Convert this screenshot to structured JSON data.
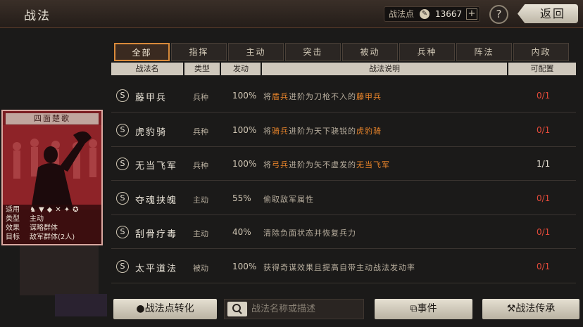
{
  "header": {
    "title": "战法",
    "points_label": "战法点",
    "points_value": "13667",
    "plus_label": "+",
    "help_label": "?",
    "back_label": "返回"
  },
  "card": {
    "name": "四面楚歌",
    "use_label": "适用",
    "type_label": "类型",
    "type_value": "主动",
    "effect_label": "效果",
    "effect_value": "谋略群体",
    "target_label": "目标",
    "target_value": "敌军群体(2人)"
  },
  "tabs": [
    {
      "label": "全部",
      "active": true
    },
    {
      "label": "指挥",
      "active": false
    },
    {
      "label": "主动",
      "active": false
    },
    {
      "label": "突击",
      "active": false
    },
    {
      "label": "被动",
      "active": false
    },
    {
      "label": "兵种",
      "active": false
    },
    {
      "label": "阵法",
      "active": false
    },
    {
      "label": "内政",
      "active": false
    }
  ],
  "columns": [
    "战法名",
    "类型",
    "发动",
    "战法说明",
    "可配置"
  ],
  "rows": [
    {
      "grade": "S",
      "name": "藤甲兵",
      "type": "兵种",
      "rate": "100%",
      "desc_parts": [
        [
          "将",
          false
        ],
        [
          "盾兵",
          true
        ],
        [
          "进阶为刀枪不入的",
          false
        ],
        [
          "藤甲兵",
          true
        ]
      ],
      "count": "0/1",
      "full": false
    },
    {
      "grade": "S",
      "name": "虎豹骑",
      "type": "兵种",
      "rate": "100%",
      "desc_parts": [
        [
          "将",
          false
        ],
        [
          "骑兵",
          true
        ],
        [
          "进阶为天下骁锐的",
          false
        ],
        [
          "虎豹骑",
          true
        ]
      ],
      "count": "0/1",
      "full": false
    },
    {
      "grade": "S",
      "name": "无当飞军",
      "type": "兵种",
      "rate": "100%",
      "desc_parts": [
        [
          "将",
          false
        ],
        [
          "弓兵",
          true
        ],
        [
          "进阶为矢不虚发的",
          false
        ],
        [
          "无当飞军",
          true
        ]
      ],
      "count": "1/1",
      "full": true
    },
    {
      "grade": "S",
      "name": "夺魂挟魄",
      "type": "主动",
      "rate": "55%",
      "desc_parts": [
        [
          "偷取敌军属性",
          false
        ]
      ],
      "count": "0/1",
      "full": false
    },
    {
      "grade": "S",
      "name": "刮骨疗毒",
      "type": "主动",
      "rate": "40%",
      "desc_parts": [
        [
          "清除负面状态并恢复兵力",
          false
        ]
      ],
      "count": "0/1",
      "full": false
    },
    {
      "grade": "S",
      "name": "太平道法",
      "type": "被动",
      "rate": "100%",
      "desc_parts": [
        [
          "获得奇谋效果且提高自带主动战法发动率",
          false
        ]
      ],
      "count": "0/1",
      "full": false
    }
  ],
  "bottom": {
    "convert_label": "战法点转化",
    "search_placeholder": "战法名称或描述",
    "event_label": "事件",
    "inherit_label": "战法传承"
  },
  "colors": {
    "accent": "#d98a3a",
    "highlight": "#e8842a",
    "count_red": "#e24a3a"
  }
}
